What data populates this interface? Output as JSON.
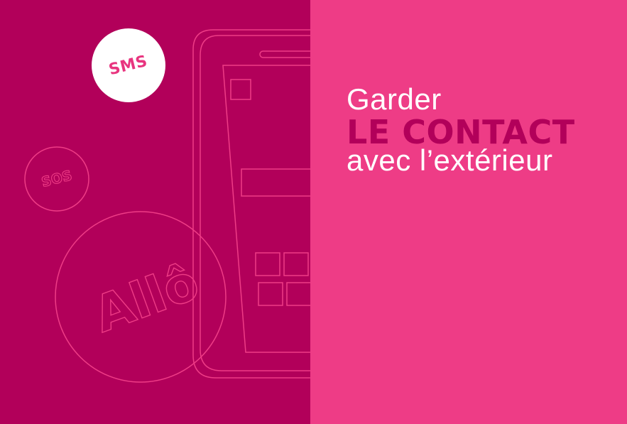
{
  "panels": {
    "left_color": "#b2005a",
    "right_color": "#ee3c86",
    "stroke_color": "#ee3c86"
  },
  "illustration": {
    "phone": "phone-outline-icon",
    "sms_label": "SMS",
    "sos_label": "SOS",
    "allo_label": "Allô"
  },
  "headline": {
    "line1": "Garder",
    "line2": "LE CONTACT",
    "line3": "avec l’extérieur"
  }
}
